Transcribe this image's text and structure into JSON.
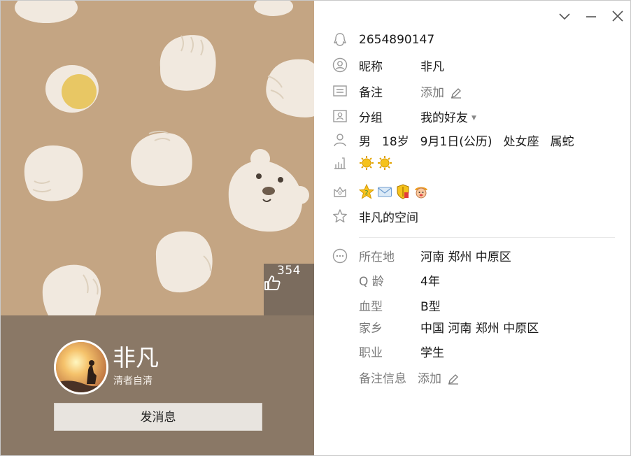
{
  "profile": {
    "name": "非凡",
    "signature": "清者自清",
    "like_count": "354",
    "send_button": "发消息"
  },
  "details": {
    "qq_number": "2654890147",
    "nickname_label": "昵称",
    "nickname_value": "非凡",
    "remark_label": "备注",
    "remark_value": "添加",
    "group_label": "分组",
    "group_value": "我的好友",
    "gender": "男",
    "age": "18岁",
    "birthday": "9月1日(公历)",
    "zodiac": "处女座",
    "chinese_zodiac": "属蛇",
    "space": "非凡的空间"
  },
  "more": {
    "location_label": "所在地",
    "location_value": "河南 郑州 中原区",
    "qage_label": "Q 龄",
    "qage_value": "4年",
    "blood_label": "血型",
    "blood_value": "B型",
    "hometown_label": "家乡",
    "hometown_value": "中国 河南 郑州 中原区",
    "job_label": "职业",
    "job_value": "学生",
    "remark_info_label": "备注信息",
    "remark_info_value": "添加"
  },
  "colors": {
    "cover_bg": "#c4a583",
    "info_bg": "#8a7866",
    "accent_sun": "#f2b400"
  },
  "icons": {
    "level": [
      "sun-icon",
      "sun-icon"
    ],
    "vip": [
      "star-badge-icon",
      "mail-badge-icon",
      "shield-badge-icon",
      "face-badge-icon"
    ]
  }
}
